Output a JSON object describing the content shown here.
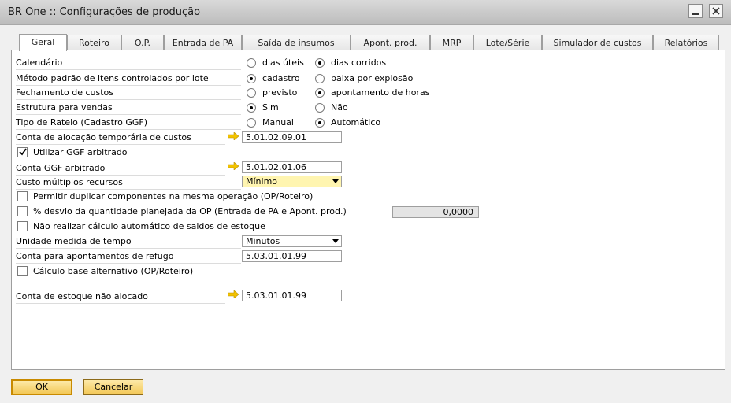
{
  "window": {
    "title": "BR One :: Configurações de produção"
  },
  "tabs": [
    "Geral",
    "Roteiro",
    "O.P.",
    "Entrada de PA",
    "Saída de insumos",
    "Apont. prod.",
    "MRP",
    "Lote/Série",
    "Simulador de custos",
    "Relatórios"
  ],
  "active_tab": "Geral",
  "radios": {
    "calendario": {
      "label": "Calendário",
      "opt1": "dias úteis",
      "opt2": "dias corridos",
      "selected": "dias corridos"
    },
    "metodo": {
      "label": "Método padrão de itens controlados por lote",
      "opt1": "cadastro",
      "opt2": "baixa por explosão",
      "selected": "cadastro"
    },
    "fechamento": {
      "label": "Fechamento de custos",
      "opt1": "previsto",
      "opt2": "apontamento de horas",
      "selected": "apontamento de horas"
    },
    "estrutura": {
      "label": "Estrutura para vendas",
      "opt1": "Sim",
      "opt2": "Não",
      "selected": "Sim"
    },
    "rateio": {
      "label": "Tipo de Rateio (Cadastro GGF)",
      "opt1": "Manual",
      "opt2": "Automático",
      "selected": "Automático"
    }
  },
  "fields": {
    "conta_alocacao": {
      "label": "Conta de alocação temporária de custos",
      "value": "5.01.02.09.01"
    },
    "utilizar_ggf": {
      "label": "Utilizar GGF arbitrado",
      "checked": true
    },
    "conta_ggf": {
      "label": "Conta GGF arbitrado",
      "value": "5.01.02.01.06"
    },
    "custo_multiplos": {
      "label": "Custo múltiplos recursos",
      "value": "Mínimo"
    },
    "permitir_duplicar": {
      "label": "Permitir duplicar componentes na mesma operação (OP/Roteiro)",
      "checked": false
    },
    "desvio": {
      "label": "% desvio da quantidade planejada da OP (Entrada de PA e Apont. prod.)",
      "checked": false,
      "value": "0,0000"
    },
    "nao_realizar": {
      "label": "Não realizar cálculo automático de saldos de estoque",
      "checked": false
    },
    "unidade_tempo": {
      "label": "Unidade medida de tempo",
      "value": "Minutos"
    },
    "conta_refugo": {
      "label": "Conta para apontamentos de refugo",
      "value": "5.03.01.01.99"
    },
    "calculo_base": {
      "label": "Cálculo base alternativo (OP/Roteiro)",
      "checked": false
    },
    "conta_estoque": {
      "label": "Conta de estoque não alocado",
      "value": "5.03.01.01.99"
    }
  },
  "buttons": {
    "ok": "OK",
    "cancel": "Cancelar"
  },
  "icons": {
    "link_arrow": "link-arrow-icon",
    "minimize": "minimize-icon",
    "close": "close-icon"
  },
  "colors": {
    "arrow": "#f2c200",
    "button": "#f3c857",
    "yellow_field": "#fff5b0"
  }
}
